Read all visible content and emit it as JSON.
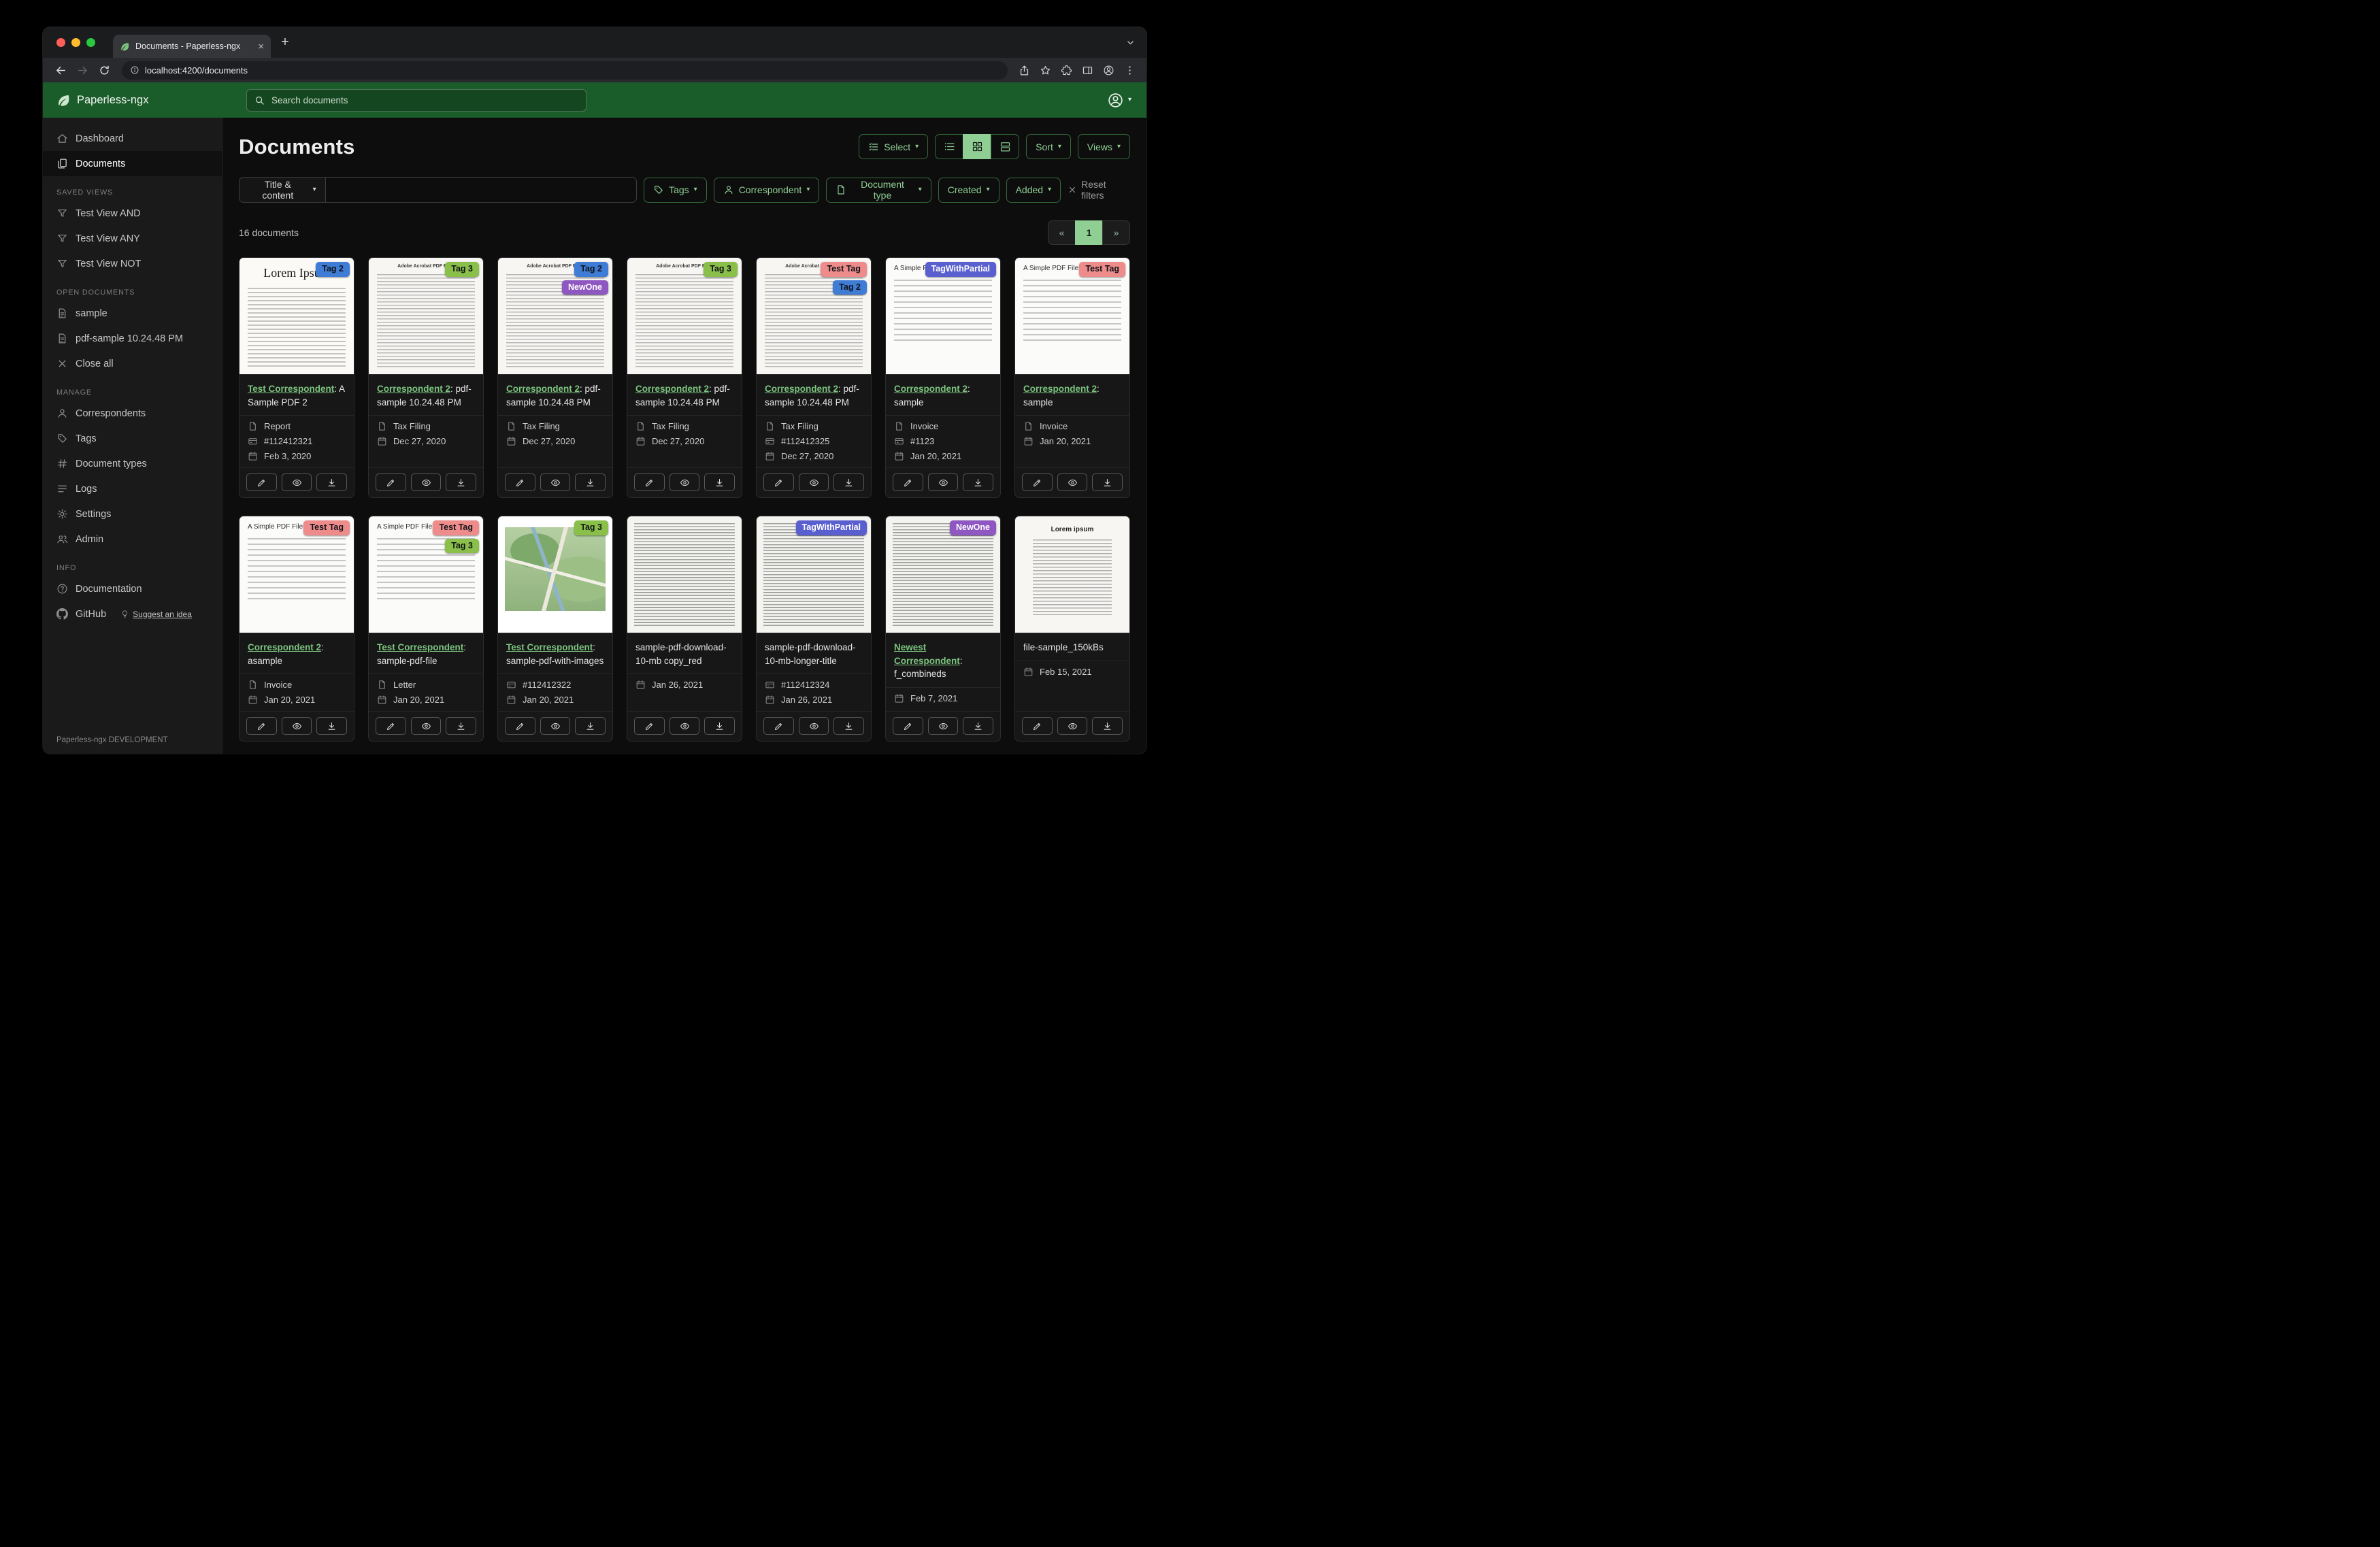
{
  "ui": {
    "caret": "▾"
  },
  "browser": {
    "tab": {
      "title": "Documents - Paperless-ngx",
      "close_glyph": "×"
    },
    "new_tab_glyph": "+",
    "url": "localhost:4200/documents"
  },
  "header": {
    "brand": "Paperless-ngx",
    "search_placeholder": "Search documents"
  },
  "sidebar": {
    "primary": [
      {
        "label": "Dashboard",
        "icon": "home"
      },
      {
        "label": "Documents",
        "icon": "documents",
        "active": true
      }
    ],
    "sections": [
      {
        "title": "SAVED VIEWS",
        "items": [
          {
            "label": "Test View AND",
            "icon": "funnel"
          },
          {
            "label": "Test View ANY",
            "icon": "funnel"
          },
          {
            "label": "Test View NOT",
            "icon": "funnel"
          }
        ]
      },
      {
        "title": "OPEN DOCUMENTS",
        "items": [
          {
            "label": "sample",
            "icon": "file-text"
          },
          {
            "label": "pdf-sample 10.24.48 PM",
            "icon": "file-text"
          },
          {
            "label": "Close all",
            "icon": "close"
          }
        ]
      },
      {
        "title": "MANAGE",
        "items": [
          {
            "label": "Correspondents",
            "icon": "person"
          },
          {
            "label": "Tags",
            "icon": "tag"
          },
          {
            "label": "Document types",
            "icon": "hash"
          },
          {
            "label": "Logs",
            "icon": "list"
          },
          {
            "label": "Settings",
            "icon": "gear"
          },
          {
            "label": "Admin",
            "icon": "people"
          }
        ]
      },
      {
        "title": "INFO",
        "items": [
          {
            "label": "Documentation",
            "icon": "question"
          },
          {
            "label": "GitHub",
            "icon": "github",
            "extra": "Suggest an idea",
            "extra_icon": "bulb"
          }
        ]
      }
    ],
    "footer": "Paperless-ngx DEVELOPMENT"
  },
  "main": {
    "title": "Documents",
    "toolbar": {
      "select_label": "Select",
      "sort_label": "Sort",
      "views_label": "Views"
    },
    "filters": {
      "title_dropdown": "Title & content",
      "buttons": [
        {
          "label": "Tags"
        },
        {
          "label": "Correspondent"
        },
        {
          "label": "Document type"
        },
        {
          "label": "Created"
        },
        {
          "label": "Added"
        }
      ],
      "reset_label": "Reset filters"
    },
    "count_label": "16 documents",
    "pagination": {
      "prev": "«",
      "current": "1",
      "next": "»"
    }
  },
  "tag_styles": {
    "Tag 2": {
      "bg": "#3e7cd6",
      "fg": "#101418"
    },
    "Tag 3": {
      "bg": "#8ac04a",
      "fg": "#101418"
    },
    "NewOne": {
      "bg": "#8e57c1",
      "fg": "#ffffff"
    },
    "Test Tag": {
      "bg": "#ee8b8b",
      "fg": "#101418"
    },
    "TagWithPartial": {
      "bg": "#5a5fd0",
      "fg": "#ffffff"
    }
  },
  "cards": [
    {
      "tags": [
        "Tag 2"
      ],
      "thumb": "lorem",
      "thumb_title": "Lorem Ipsum",
      "link": "Test Correspondent",
      "rest": ": A Sample PDF 2",
      "type": "Report",
      "asn": "#112412321",
      "date": "Feb 3, 2020"
    },
    {
      "tags": [
        "Tag 3"
      ],
      "thumb": "acrobat",
      "thumb_title": "Adobe Acrobat PDF Files",
      "link": "Correspondent 2",
      "rest": ": pdf-sample 10.24.48 PM",
      "type": "Tax Filing",
      "date": "Dec 27, 2020"
    },
    {
      "tags": [
        "Tag 2",
        "NewOne"
      ],
      "thumb": "acrobat",
      "thumb_title": "Adobe Acrobat PDF Files",
      "link": "Correspondent 2",
      "rest": ": pdf-sample 10.24.48 PM",
      "type": "Tax Filing",
      "date": "Dec 27, 2020"
    },
    {
      "tags": [
        "Tag 3"
      ],
      "thumb": "acrobat",
      "thumb_title": "Adobe Acrobat PDF Files",
      "link": "Correspondent 2",
      "rest": ": pdf-sample 10.24.48 PM",
      "type": "Tax Filing",
      "date": "Dec 27, 2020"
    },
    {
      "tags": [
        "Test Tag",
        "Tag 2"
      ],
      "thumb": "acrobat",
      "thumb_title": "Adobe Acrobat PDF Files",
      "link": "Correspondent 2",
      "rest": ": pdf-sample 10.24.48 PM",
      "type": "Tax Filing",
      "asn": "#112412325",
      "date": "Dec 27, 2020"
    },
    {
      "tags": [
        "TagWithPartial"
      ],
      "thumb": "simple",
      "thumb_title": "A Simple PDF File",
      "link": "Correspondent 2",
      "rest": ": sample",
      "type": "Invoice",
      "asn": "#1123",
      "date": "Jan 20, 2021"
    },
    {
      "tags": [
        "Test Tag"
      ],
      "thumb": "simple",
      "thumb_title": "A Simple PDF File",
      "link": "Correspondent 2",
      "rest": ": sample",
      "type": "Invoice",
      "date": "Jan 20, 2021"
    },
    {
      "tags": [
        "Test Tag"
      ],
      "thumb": "simple",
      "thumb_title": "A Simple PDF File",
      "link": "Correspondent 2",
      "rest": ": asample",
      "type": "Invoice",
      "date": "Jan 20, 2021"
    },
    {
      "tags": [
        "Test Tag",
        "Tag 3"
      ],
      "thumb": "simple",
      "thumb_title": "A Simple PDF File",
      "link": "Test Correspondent",
      "rest": ": sample-pdf-file",
      "type": "Letter",
      "date": "Jan 20, 2021"
    },
    {
      "tags": [
        "Tag 3"
      ],
      "thumb": "map",
      "link": "Test Correspondent",
      "rest": ": sample-pdf-with-images",
      "asn": "#112412322",
      "date": "Jan 20, 2021"
    },
    {
      "tags": [],
      "thumb": "dense",
      "title": "sample-pdf-download-10-mb copy_red",
      "date": "Jan 26, 2021"
    },
    {
      "tags": [
        "TagWithPartial"
      ],
      "thumb": "dense",
      "title": "sample-pdf-download-10-mb-longer-title",
      "asn": "#112412324",
      "date": "Jan 26, 2021"
    },
    {
      "tags": [
        "NewOne"
      ],
      "thumb": "dense",
      "link": "Newest Correspondent",
      "rest": ": f_combineds",
      "date": "Feb 7, 2021"
    },
    {
      "tags": [],
      "thumb": "lorem2",
      "thumb_title": "Lorem ipsum",
      "title": "file-sample_150kBs",
      "date": "Feb 15, 2021"
    }
  ]
}
